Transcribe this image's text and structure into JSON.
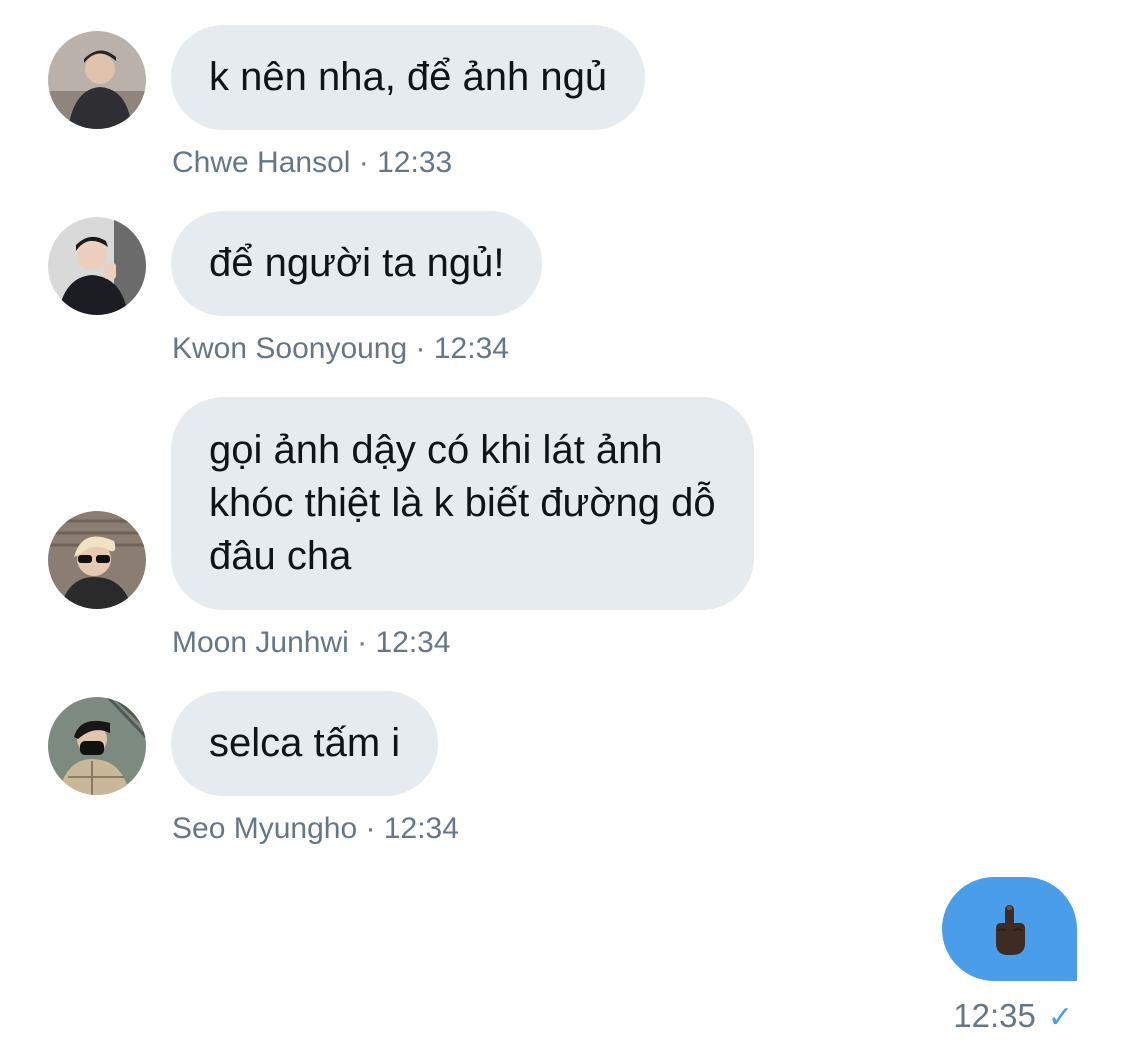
{
  "messages": [
    {
      "text": "k nên nha, để ảnh ngủ",
      "sender": "Chwe Hansol",
      "time": "12:33"
    },
    {
      "text": "để người ta ngủ!",
      "sender": "Kwon Soonyoung",
      "time": "12:34"
    },
    {
      "lines": [
        "gọi ảnh dậy có khi lát ảnh",
        "khóc thiệt là k biết đường dỗ",
        "đâu cha"
      ],
      "sender": "Moon Junhwi",
      "time": "12:34"
    },
    {
      "text": "selca tấm i",
      "sender": "Seo Myungho",
      "time": "12:34"
    }
  ],
  "separator": "·",
  "sent": {
    "emoji": "middle-finger-emoji",
    "time": "12:35",
    "status_icon": "check-icon"
  },
  "colors": {
    "incoming_bubble": "#e6ebf0",
    "outgoing_bubble": "#4a9ee9",
    "meta_text": "#657786"
  }
}
